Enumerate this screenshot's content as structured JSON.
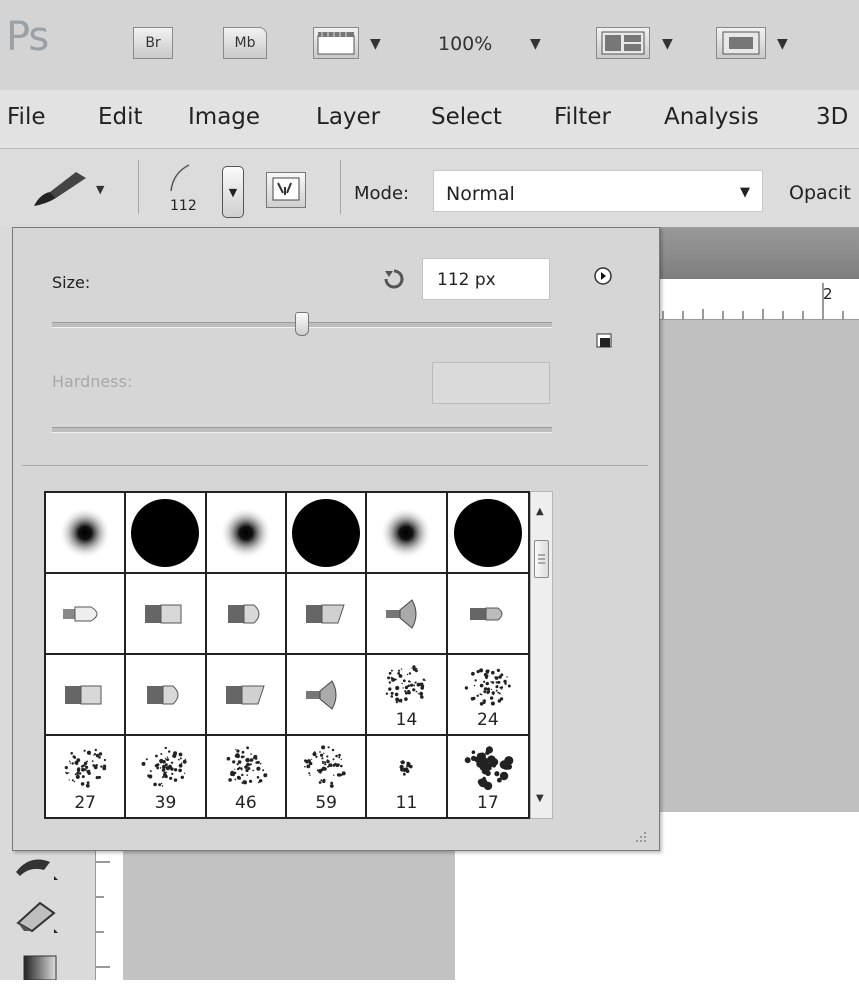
{
  "app": {
    "logo": "Ps"
  },
  "appbar": {
    "bridge_label": "Br",
    "minibridge_label": "Mb",
    "zoom_value": "100%"
  },
  "menu": [
    "File",
    "Edit",
    "Image",
    "Layer",
    "Select",
    "Filter",
    "Analysis",
    "3D"
  ],
  "options": {
    "brush_size_preview": "112",
    "mode_label": "Mode:",
    "mode_value": "Normal",
    "opacity_label": "Opacit"
  },
  "ruler": {
    "tick_label": "2"
  },
  "brush_panel": {
    "size_label": "Size:",
    "size_value": "112 px",
    "size_level": 0.5,
    "hardness_label": "Hardness:",
    "hardness_value": "",
    "presets": [
      {
        "type": "soft-round",
        "size": ""
      },
      {
        "type": "hard-round",
        "size": ""
      },
      {
        "type": "soft-round",
        "size": ""
      },
      {
        "type": "hard-round",
        "size": ""
      },
      {
        "type": "soft-round",
        "size": ""
      },
      {
        "type": "hard-round",
        "size": ""
      },
      {
        "type": "bristle-point",
        "size": ""
      },
      {
        "type": "bristle-flat",
        "size": ""
      },
      {
        "type": "bristle-round",
        "size": ""
      },
      {
        "type": "bristle-angle",
        "size": ""
      },
      {
        "type": "bristle-fan",
        "size": ""
      },
      {
        "type": "bristle-blunt",
        "size": ""
      },
      {
        "type": "bristle-flat",
        "size": ""
      },
      {
        "type": "bristle-round",
        "size": ""
      },
      {
        "type": "bristle-angle",
        "size": ""
      },
      {
        "type": "bristle-fan",
        "size": ""
      },
      {
        "type": "scatter",
        "size": "14"
      },
      {
        "type": "scatter",
        "size": "24"
      },
      {
        "type": "scatter",
        "size": "27"
      },
      {
        "type": "scatter",
        "size": "39"
      },
      {
        "type": "scatter",
        "size": "46"
      },
      {
        "type": "scatter",
        "size": "59"
      },
      {
        "type": "scatter-small",
        "size": "11"
      },
      {
        "type": "scatter-blob",
        "size": "17"
      }
    ]
  },
  "colors": {
    "ui_bg": "#d6d6d6",
    "canvas_gray": "#c0c0c0"
  }
}
